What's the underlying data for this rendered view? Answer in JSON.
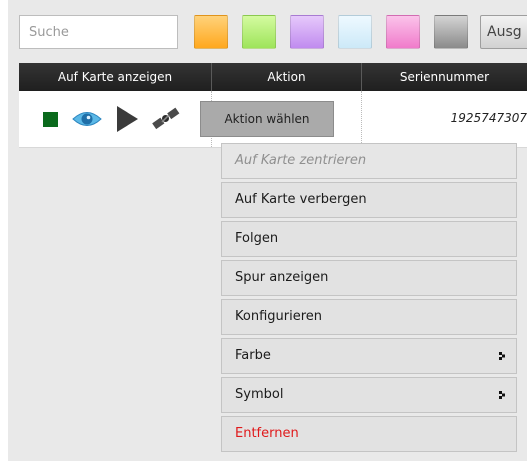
{
  "toolbar": {
    "search_placeholder": "Suche",
    "swatches": [
      {
        "name": "orange",
        "color": "#ffbe4d"
      },
      {
        "name": "green",
        "color": "#b7f07a"
      },
      {
        "name": "purple",
        "color": "#d2a8f5"
      },
      {
        "name": "lightblue",
        "color": "#daf0fb"
      },
      {
        "name": "pink",
        "color": "#f69ad8"
      },
      {
        "name": "gray",
        "color": "#a9a9a9"
      }
    ],
    "button_label": "Ausg"
  },
  "table": {
    "columns": [
      "Auf Karte anzeigen",
      "Aktion",
      "Seriennummer"
    ],
    "row": {
      "row_icons": [
        "status-square-icon",
        "eye-icon",
        "play-icon",
        "satellite-icon"
      ],
      "status_color": "#0a6a1c",
      "action_button": "Aktion wählen",
      "serial": "1925747307"
    }
  },
  "menu": {
    "items": [
      {
        "label": "Auf Karte zentrieren",
        "state": "disabled"
      },
      {
        "label": "Auf Karte verbergen"
      },
      {
        "label": "Folgen"
      },
      {
        "label": "Spur anzeigen"
      },
      {
        "label": "Konfigurieren"
      },
      {
        "label": "Farbe",
        "submenu": true
      },
      {
        "label": "Symbol",
        "submenu": true
      },
      {
        "label": "Entfernen",
        "state": "danger",
        "color": "#e0191b"
      }
    ]
  }
}
